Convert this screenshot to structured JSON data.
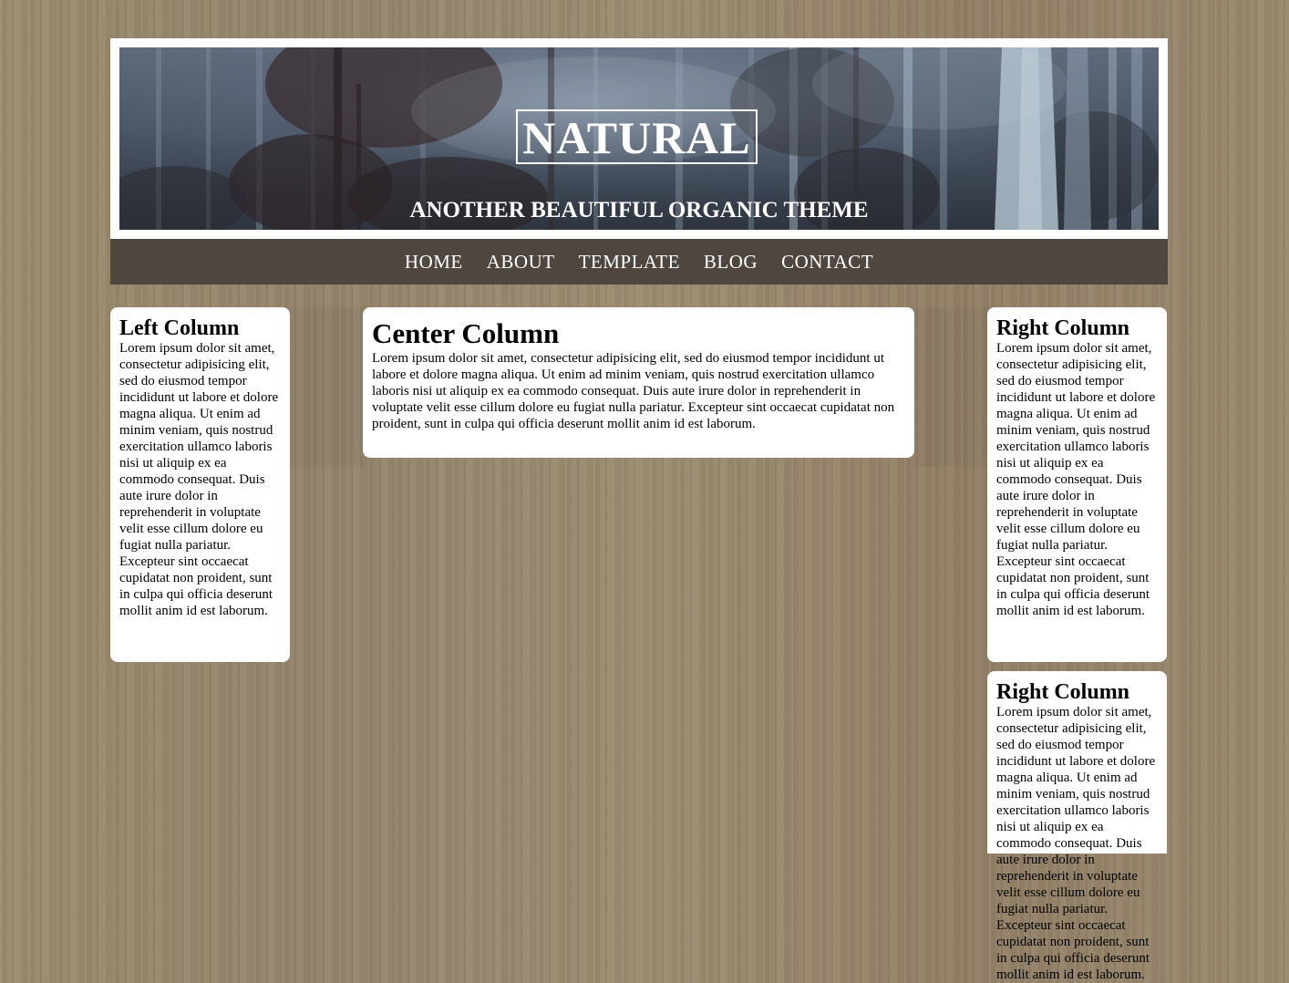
{
  "header": {
    "title": "NATURAL",
    "tagline": "ANOTHER BEAUTIFUL ORGANIC THEME"
  },
  "nav": {
    "items": [
      {
        "label": "HOME"
      },
      {
        "label": "ABOUT"
      },
      {
        "label": "TEMPLATE"
      },
      {
        "label": "BLOG"
      },
      {
        "label": "CONTACT"
      }
    ]
  },
  "left_column": {
    "heading": "Left Column",
    "text": "Lorem ipsum dolor sit amet, consectetur adipisicing elit, sed do eiusmod tempor incididunt ut labore et dolore magna aliqua. Ut enim ad minim veniam, quis nostrud exercitation ullamco laboris nisi ut aliquip ex ea commodo consequat. Duis aute irure dolor in reprehenderit in voluptate velit esse cillum dolore eu fugiat nulla pariatur. Excepteur sint occaecat cupidatat non proident, sunt in culpa qui officia deserunt mollit anim id est laborum."
  },
  "center_column": {
    "heading": "Center Column",
    "text": "Lorem ipsum dolor sit amet, consectetur adipisicing elit, sed do eiusmod tempor incididunt ut labore et dolore magna aliqua. Ut enim ad minim veniam, quis nostrud exercitation ullamco laboris nisi ut aliquip ex ea commodo consequat. Duis aute irure dolor in reprehenderit in voluptate velit esse cillum dolore eu fugiat nulla pariatur. Excepteur sint occaecat cupidatat non proident, sunt in culpa qui officia deserunt mollit anim id est laborum."
  },
  "right_columns": [
    {
      "heading": "Right Column",
      "text": "Lorem ipsum dolor sit amet, consectetur adipisicing elit, sed do eiusmod tempor incididunt ut labore et dolore magna aliqua. Ut enim ad minim veniam, quis nostrud exercitation ullamco laboris nisi ut aliquip ex ea commodo consequat. Duis aute irure dolor in reprehenderit in voluptate velit esse cillum dolore eu fugiat nulla pariatur. Excepteur sint occaecat cupidatat non proident, sunt in culpa qui officia deserunt mollit anim id est laborum."
    },
    {
      "heading": "Right Column",
      "text": "Lorem ipsum dolor sit amet, consectetur adipisicing elit, sed do eiusmod tempor incididunt ut labore et dolore magna aliqua. Ut enim ad minim veniam, quis nostrud exercitation ullamco laboris nisi ut aliquip ex ea commodo consequat. Duis aute irure dolor in reprehenderit in voluptate velit esse cillum dolore eu fugiat nulla pariatur. Excepteur sint occaecat cupidatat non proident, sunt in culpa qui officia deserunt mollit anim id est laborum."
    }
  ],
  "colors": {
    "background_wood": "#968669",
    "nav_bar": "#4f4640",
    "panel": "#ffffff",
    "header_frame": "#ffffff"
  }
}
